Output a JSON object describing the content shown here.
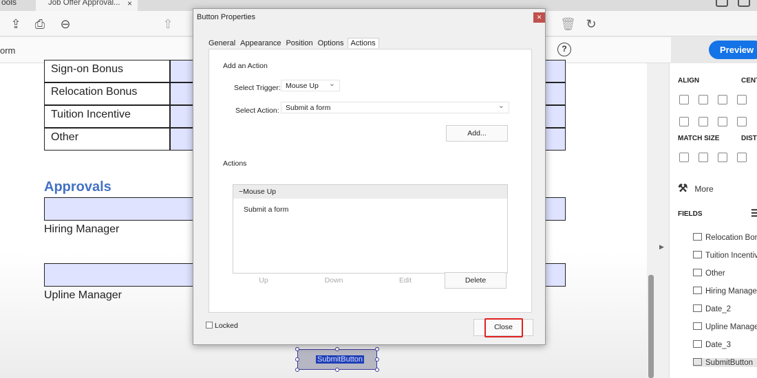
{
  "tabs": {
    "tools_label": "ools",
    "doc_tab_label": "Job Offer Approval...",
    "doc_tab_close": "×"
  },
  "subbar": {
    "form_label": "orm",
    "help_icon": "?",
    "preview_label": "Preview"
  },
  "document": {
    "rows": [
      "Sign-on Bonus",
      "Relocation Bonus",
      "Tuition Incentive",
      "Other"
    ],
    "section_heading": "Approvals",
    "hiring_manager_label": "Hiring Manager",
    "upline_manager_label": "Upline Manager",
    "submit_button_text": "SubmitButton"
  },
  "right_panel": {
    "align_heading": "ALIGN",
    "center_heading": "CENT",
    "match_size_heading": "MATCH SIZE",
    "distribute_heading": "DISTI",
    "more_label": "More",
    "fields_heading": "FIELDS",
    "fields": [
      "Relocation Boni",
      "Tuition Incentiv",
      "Other",
      "Hiring Manage",
      "Date_2",
      "Upline Manage",
      "Date_3",
      "SubmitButton"
    ],
    "selected_field": "SubmitButton"
  },
  "dialog": {
    "title": "Button Properties",
    "tabs": [
      "General",
      "Appearance",
      "Position",
      "Options",
      "Actions"
    ],
    "active_tab": "Actions",
    "add_action_heading": "Add an Action",
    "select_trigger_label": "Select Trigger:",
    "select_trigger_value": "Mouse Up",
    "select_action_label": "Select Action:",
    "select_action_value": "Submit a form",
    "add_button": "Add...",
    "actions_heading": "Actions",
    "actions_tree_header": "Mouse Up",
    "actions_tree_item": "Submit a form",
    "up_button": "Up",
    "down_button": "Down",
    "edit_button": "Edit",
    "delete_button": "Delete",
    "locked_label": "Locked",
    "close_button": "Close"
  },
  "colors": {
    "preview_button": "#1473e6",
    "heading_blue": "#4472c4",
    "field_fill": "#dfe3ff",
    "highlight_red": "#e02020"
  }
}
